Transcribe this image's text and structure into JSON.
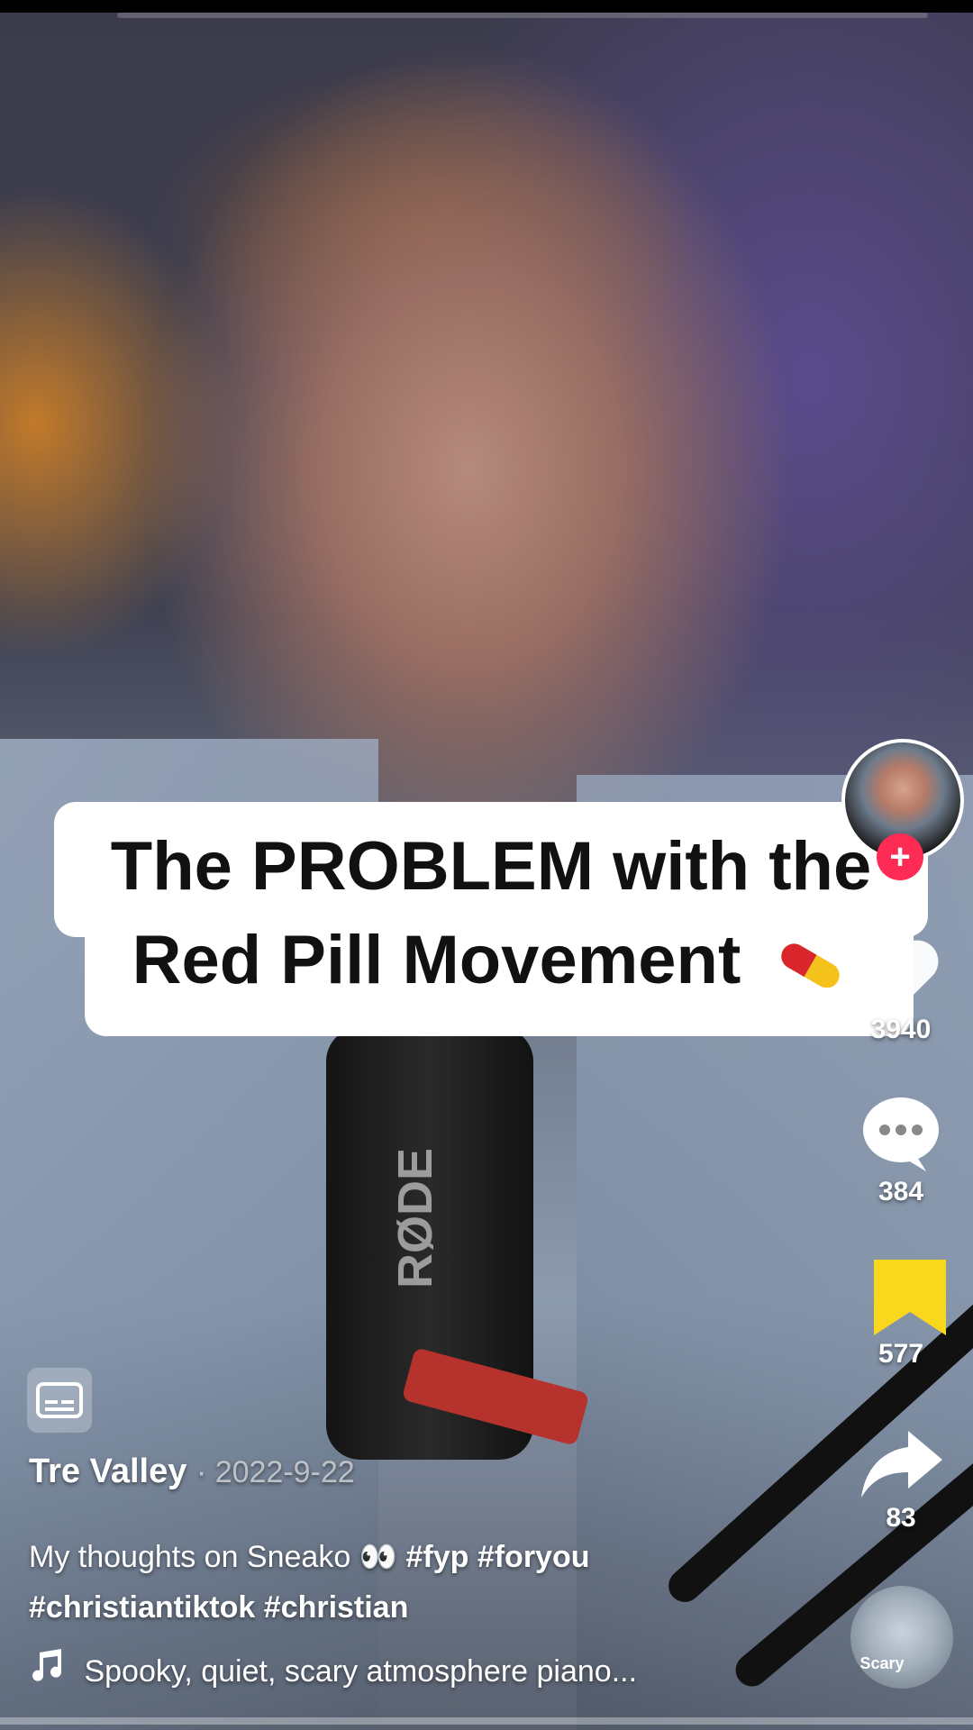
{
  "overlay": {
    "line1": "The PROBLEM with the",
    "line2": "Red Pill Movement"
  },
  "actions": {
    "likes": "3940",
    "comments": "384",
    "saves": "577",
    "shares": "83"
  },
  "post": {
    "username": "Tre Valley",
    "date": "· 2022-9-22",
    "description_text": "My thoughts on Sneako 👀",
    "hashtags_line1": "#fyp #foryou",
    "hashtags_line2": "#christiantiktok #christian"
  },
  "music": {
    "title": "Spooky, quiet, scary atmosphere piano...",
    "disc_label": "Scary"
  },
  "colors": {
    "follow": "#fe2c55",
    "bookmark_active": "#f9d71c"
  },
  "icons": [
    "heart-icon",
    "comment-icon",
    "bookmark-icon",
    "share-icon",
    "captions-icon",
    "music-note-icon",
    "plus-icon"
  ]
}
